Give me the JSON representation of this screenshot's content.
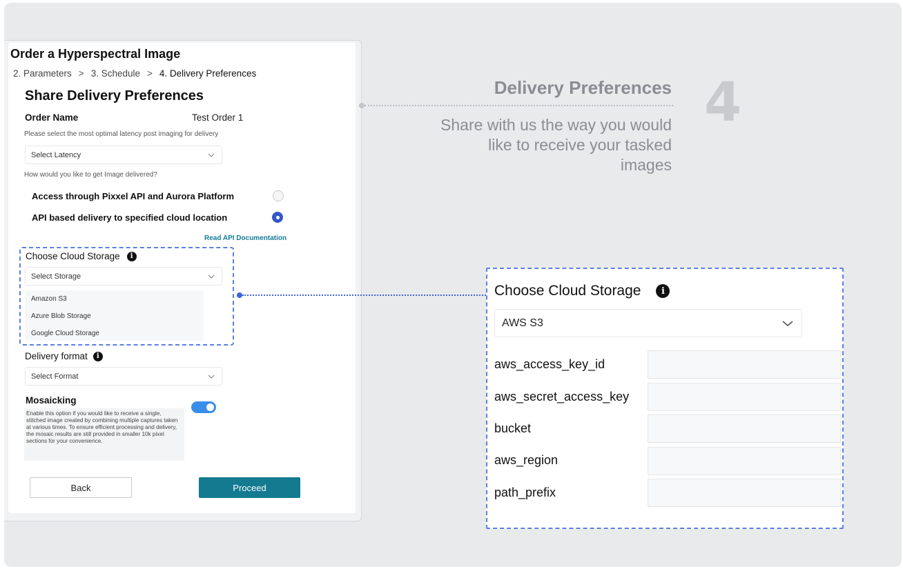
{
  "form": {
    "title": "Order a Hyperspectral Image",
    "breadcrumb": {
      "step2": "2. Parameters",
      "step3": "3. Schedule",
      "step4": "4. Delivery Preferences",
      "separator": ">"
    },
    "section_title": "Share Delivery Preferences",
    "order_name_label": "Order Name",
    "order_name_value": "Test Order 1",
    "latency_question": "Please select the most optimal latency post imaging for delivery",
    "latency_placeholder": "Select Latency",
    "delivery_question": "How would you like to get Image delivered?",
    "radio_options": [
      {
        "label": "Access through Pixxel API and Aurora Platform",
        "selected": false
      },
      {
        "label": "API based delivery to specified cloud location",
        "selected": true
      }
    ],
    "api_link": "Read API Documentation",
    "cloud_storage_label": "Choose Cloud Storage",
    "storage_placeholder": "Select Storage",
    "storage_options": [
      "Amazon S3",
      "Azure Blob Storage",
      "Google Cloud Storage"
    ],
    "delivery_format_label": "Delivery format",
    "format_placeholder": "Select Format",
    "mosaicking_label": "Mosaicking",
    "mosaicking_description": "Enable this option if you would like to receive a single, stitched image created by combining multiple captures taken at various times. To ensure efficient processing and delivery, the mosaic results are still provided in smaller 10k pixel sections for your convenience.",
    "mosaicking_enabled": true,
    "back_button": "Back",
    "proceed_button": "Proceed"
  },
  "callout": {
    "heading": "Delivery Preferences",
    "step_number": "4",
    "description": "Share with us the way you would like to receive your tasked images"
  },
  "zoom": {
    "title": "Choose Cloud Storage",
    "selected_storage": "AWS S3",
    "fields": [
      {
        "label": "aws_access_key_id",
        "value": ""
      },
      {
        "label": "aws_secret_access_key",
        "value": ""
      },
      {
        "label": "bucket",
        "value": ""
      },
      {
        "label": "aws_region",
        "value": ""
      },
      {
        "label": "path_prefix",
        "value": ""
      }
    ]
  },
  "colors": {
    "accent": "#137a90",
    "radio_selected": "#3557c8",
    "toggle_on": "#3a8de8",
    "highlight_dash": "#5b7fe0",
    "link": "#147d96"
  }
}
